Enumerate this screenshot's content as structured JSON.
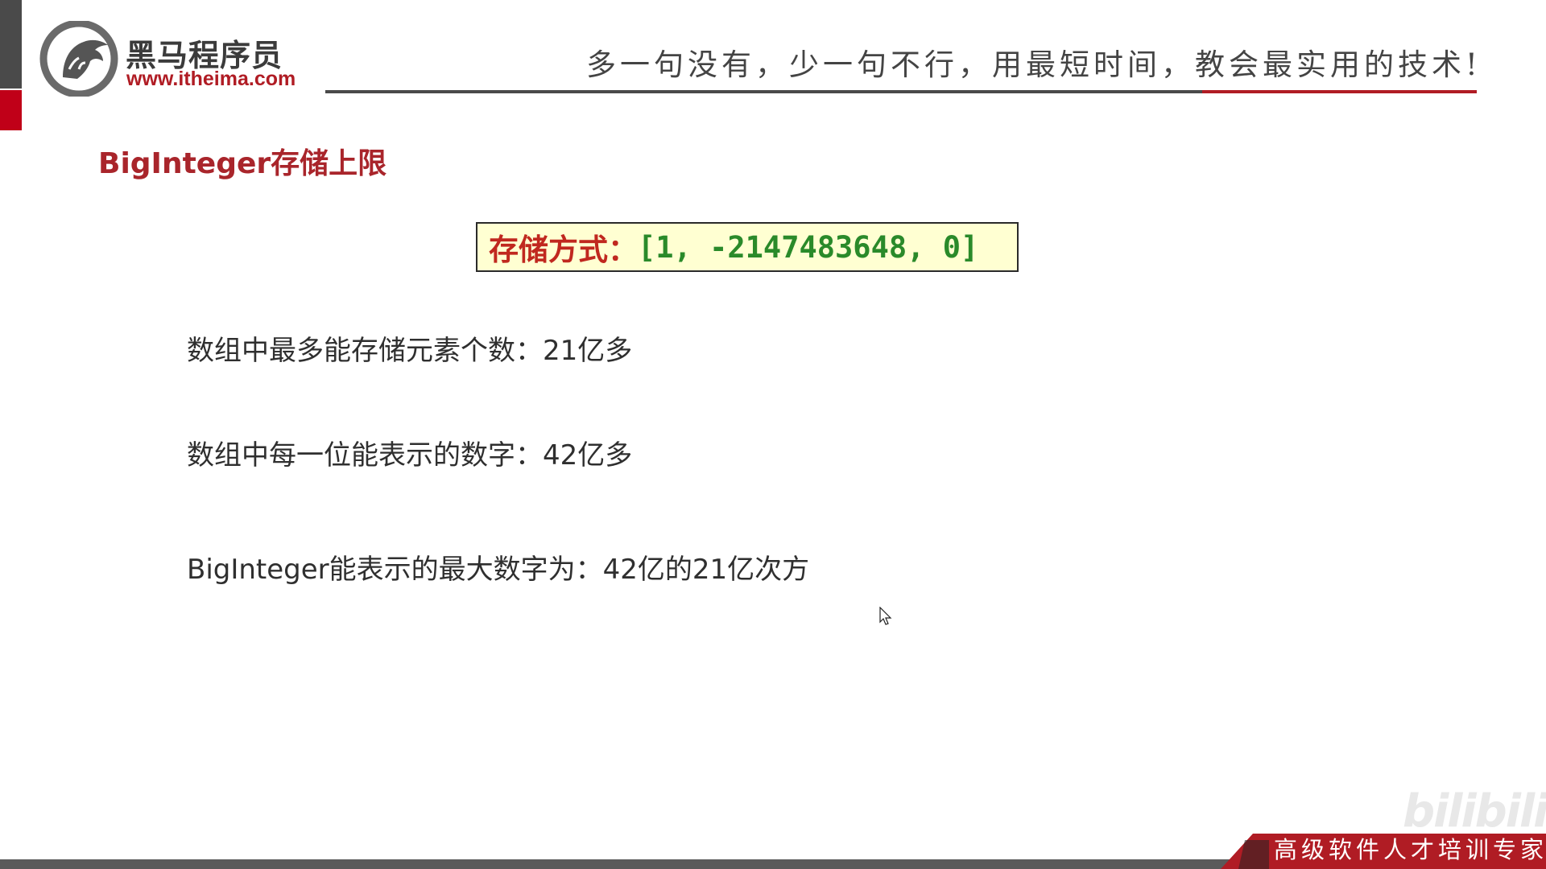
{
  "header": {
    "brand_name": "黑马程序员",
    "brand_url": "www.itheima.com",
    "slogan": "多一句没有，少一句不行，用最短时间，教会最实用的技术!",
    "logo_icon": "horse-head-logo-icon"
  },
  "slide": {
    "title": "BigInteger存储上限",
    "storage": {
      "label": "存储方式：",
      "value": "[1, -2147483648, 0]"
    },
    "facts": [
      "数组中最多能存储元素个数：21亿多",
      "数组中每一位能表示的数字：42亿多",
      "BigInteger能表示的最大数字为：42亿的21亿次方"
    ]
  },
  "footer": {
    "tag": "高级软件人才培训专家"
  },
  "watermark": "bilibili",
  "colors": {
    "accent_red": "#a9252b",
    "box_background": "#ffffd2",
    "value_green": "#2a8a2a",
    "label_red": "#c0281f"
  }
}
